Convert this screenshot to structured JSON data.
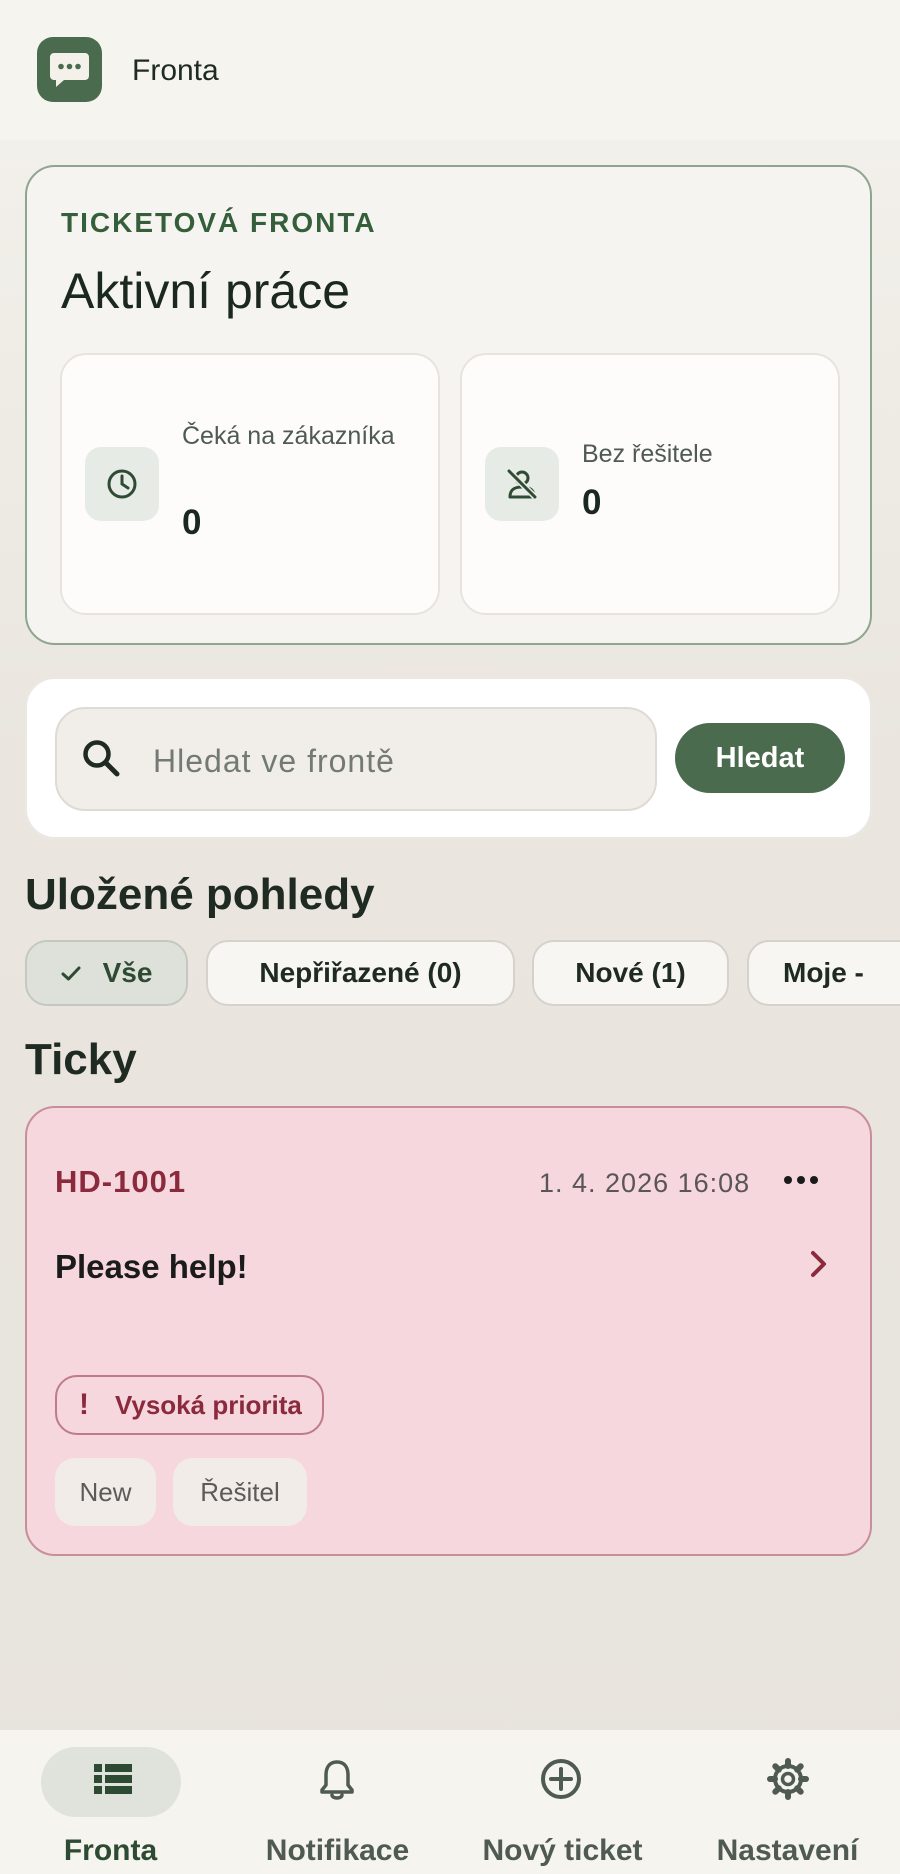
{
  "app": {
    "title": "Fronta"
  },
  "summary": {
    "eyebrow": "TICKETOVÁ FRONTA",
    "title": "Aktivní práce",
    "stats": [
      {
        "label": "Čeká na zákazníka",
        "value": "0",
        "icon": "clock-icon"
      },
      {
        "label": "Bez řešitele",
        "value": "0",
        "icon": "person-off-icon"
      }
    ]
  },
  "search": {
    "placeholder": "Hledat ve frontě",
    "button_label": "Hledat"
  },
  "saved_views": {
    "title": "Uložené pohledy",
    "chips": [
      "Vše",
      "Nepřiřazené (0)",
      "Nové (1)",
      "Moje - "
    ]
  },
  "tickets": {
    "title": "Ticky",
    "items": [
      {
        "id": "HD-1001",
        "date": "1. 4. 2026 16:08",
        "subject": "Please help!",
        "priority": "Vysoká priorita",
        "tags": [
          "New",
          "Řešitel"
        ]
      }
    ]
  },
  "nav": {
    "items": [
      {
        "label": "Fronta",
        "icon": "list-icon",
        "active": true
      },
      {
        "label": "Notifikace",
        "icon": "bell-icon"
      },
      {
        "label": "Nový ticket",
        "icon": "add-circle-icon"
      },
      {
        "label": "Nastavení",
        "icon": "gear-icon"
      }
    ]
  },
  "colors": {
    "accent": "#4b6b4e",
    "ticket_background": "#f5d7dd",
    "priority_text": "#8b2a3c"
  }
}
